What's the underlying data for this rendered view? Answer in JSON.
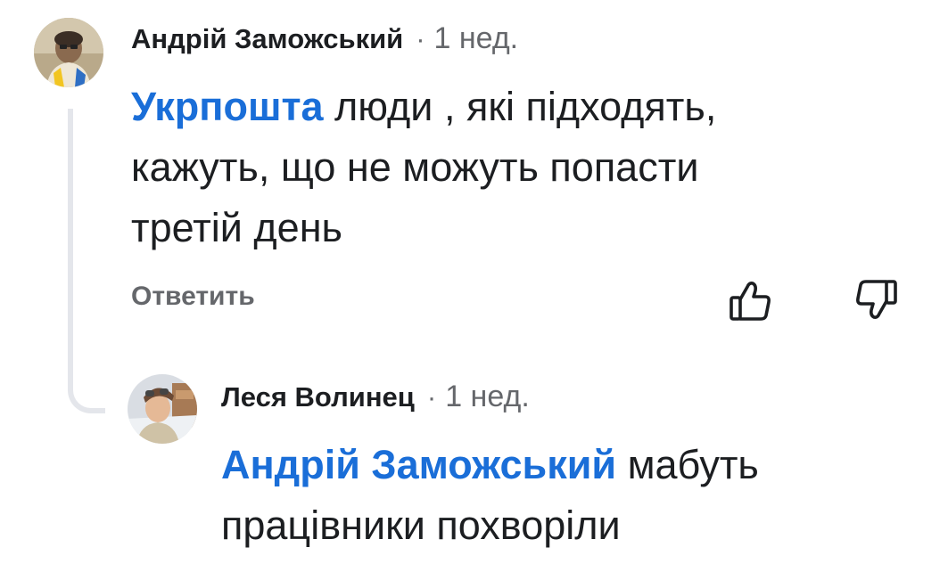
{
  "comments": [
    {
      "author": "Андрій Заможський",
      "separator": "·",
      "time": "1 нед.",
      "mention": "Укрпошта",
      "text_line1": " люди , які підходять,",
      "text_line2": "кажуть, що не можуть попасти",
      "text_line3": "третій день",
      "reply_label": "Ответить",
      "like_icon": "thumbs-up-icon",
      "dislike_icon": "thumbs-down-icon"
    },
    {
      "author": "Леся Волинец",
      "separator": "·",
      "time": "1 нед.",
      "mention": "Андрій Заможський",
      "text_line1": " мабуть",
      "text_line2": "працівники похворіли"
    }
  ],
  "colors": {
    "mention": "#1a6ed8",
    "text": "#1c1e21",
    "secondary": "#65676b",
    "connector": "#e4e6eb"
  }
}
